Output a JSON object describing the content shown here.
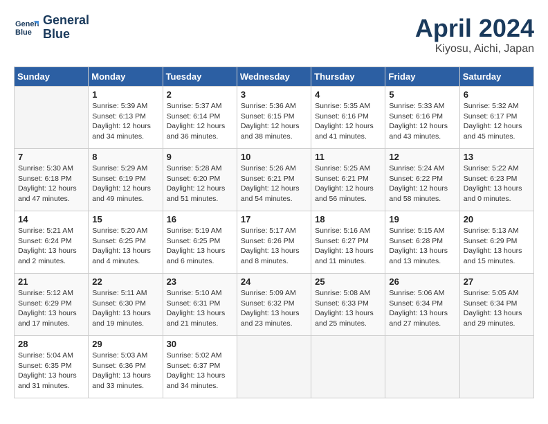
{
  "header": {
    "logo_line1": "General",
    "logo_line2": "Blue",
    "title": "April 2024",
    "subtitle": "Kiyosu, Aichi, Japan"
  },
  "days_of_week": [
    "Sunday",
    "Monday",
    "Tuesday",
    "Wednesday",
    "Thursday",
    "Friday",
    "Saturday"
  ],
  "weeks": [
    [
      {
        "day": "",
        "info": ""
      },
      {
        "day": "1",
        "info": "Sunrise: 5:39 AM\nSunset: 6:13 PM\nDaylight: 12 hours\nand 34 minutes."
      },
      {
        "day": "2",
        "info": "Sunrise: 5:37 AM\nSunset: 6:14 PM\nDaylight: 12 hours\nand 36 minutes."
      },
      {
        "day": "3",
        "info": "Sunrise: 5:36 AM\nSunset: 6:15 PM\nDaylight: 12 hours\nand 38 minutes."
      },
      {
        "day": "4",
        "info": "Sunrise: 5:35 AM\nSunset: 6:16 PM\nDaylight: 12 hours\nand 41 minutes."
      },
      {
        "day": "5",
        "info": "Sunrise: 5:33 AM\nSunset: 6:16 PM\nDaylight: 12 hours\nand 43 minutes."
      },
      {
        "day": "6",
        "info": "Sunrise: 5:32 AM\nSunset: 6:17 PM\nDaylight: 12 hours\nand 45 minutes."
      }
    ],
    [
      {
        "day": "7",
        "info": "Sunrise: 5:30 AM\nSunset: 6:18 PM\nDaylight: 12 hours\nand 47 minutes."
      },
      {
        "day": "8",
        "info": "Sunrise: 5:29 AM\nSunset: 6:19 PM\nDaylight: 12 hours\nand 49 minutes."
      },
      {
        "day": "9",
        "info": "Sunrise: 5:28 AM\nSunset: 6:20 PM\nDaylight: 12 hours\nand 51 minutes."
      },
      {
        "day": "10",
        "info": "Sunrise: 5:26 AM\nSunset: 6:21 PM\nDaylight: 12 hours\nand 54 minutes."
      },
      {
        "day": "11",
        "info": "Sunrise: 5:25 AM\nSunset: 6:21 PM\nDaylight: 12 hours\nand 56 minutes."
      },
      {
        "day": "12",
        "info": "Sunrise: 5:24 AM\nSunset: 6:22 PM\nDaylight: 12 hours\nand 58 minutes."
      },
      {
        "day": "13",
        "info": "Sunrise: 5:22 AM\nSunset: 6:23 PM\nDaylight: 13 hours\nand 0 minutes."
      }
    ],
    [
      {
        "day": "14",
        "info": "Sunrise: 5:21 AM\nSunset: 6:24 PM\nDaylight: 13 hours\nand 2 minutes."
      },
      {
        "day": "15",
        "info": "Sunrise: 5:20 AM\nSunset: 6:25 PM\nDaylight: 13 hours\nand 4 minutes."
      },
      {
        "day": "16",
        "info": "Sunrise: 5:19 AM\nSunset: 6:25 PM\nDaylight: 13 hours\nand 6 minutes."
      },
      {
        "day": "17",
        "info": "Sunrise: 5:17 AM\nSunset: 6:26 PM\nDaylight: 13 hours\nand 8 minutes."
      },
      {
        "day": "18",
        "info": "Sunrise: 5:16 AM\nSunset: 6:27 PM\nDaylight: 13 hours\nand 11 minutes."
      },
      {
        "day": "19",
        "info": "Sunrise: 5:15 AM\nSunset: 6:28 PM\nDaylight: 13 hours\nand 13 minutes."
      },
      {
        "day": "20",
        "info": "Sunrise: 5:13 AM\nSunset: 6:29 PM\nDaylight: 13 hours\nand 15 minutes."
      }
    ],
    [
      {
        "day": "21",
        "info": "Sunrise: 5:12 AM\nSunset: 6:29 PM\nDaylight: 13 hours\nand 17 minutes."
      },
      {
        "day": "22",
        "info": "Sunrise: 5:11 AM\nSunset: 6:30 PM\nDaylight: 13 hours\nand 19 minutes."
      },
      {
        "day": "23",
        "info": "Sunrise: 5:10 AM\nSunset: 6:31 PM\nDaylight: 13 hours\nand 21 minutes."
      },
      {
        "day": "24",
        "info": "Sunrise: 5:09 AM\nSunset: 6:32 PM\nDaylight: 13 hours\nand 23 minutes."
      },
      {
        "day": "25",
        "info": "Sunrise: 5:08 AM\nSunset: 6:33 PM\nDaylight: 13 hours\nand 25 minutes."
      },
      {
        "day": "26",
        "info": "Sunrise: 5:06 AM\nSunset: 6:34 PM\nDaylight: 13 hours\nand 27 minutes."
      },
      {
        "day": "27",
        "info": "Sunrise: 5:05 AM\nSunset: 6:34 PM\nDaylight: 13 hours\nand 29 minutes."
      }
    ],
    [
      {
        "day": "28",
        "info": "Sunrise: 5:04 AM\nSunset: 6:35 PM\nDaylight: 13 hours\nand 31 minutes."
      },
      {
        "day": "29",
        "info": "Sunrise: 5:03 AM\nSunset: 6:36 PM\nDaylight: 13 hours\nand 33 minutes."
      },
      {
        "day": "30",
        "info": "Sunrise: 5:02 AM\nSunset: 6:37 PM\nDaylight: 13 hours\nand 34 minutes."
      },
      {
        "day": "",
        "info": ""
      },
      {
        "day": "",
        "info": ""
      },
      {
        "day": "",
        "info": ""
      },
      {
        "day": "",
        "info": ""
      }
    ]
  ]
}
